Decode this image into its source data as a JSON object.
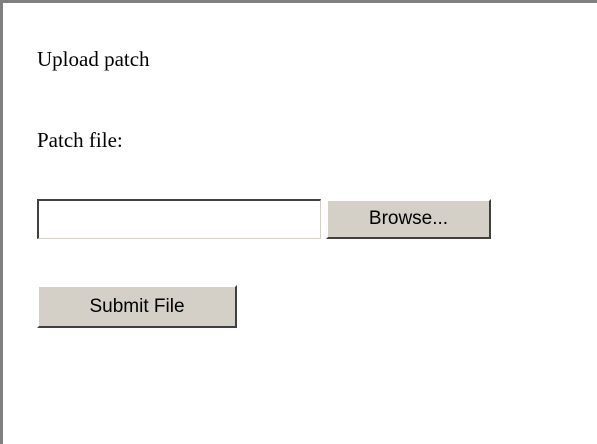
{
  "form": {
    "heading": "Upload patch",
    "patch_file_label": "Patch file:",
    "file_input_value": "",
    "browse_label": "Browse...",
    "submit_label": "Submit File"
  },
  "colors": {
    "background": "#ffffff",
    "button_face": "#d4d0c8",
    "frame_border": "#808080"
  }
}
